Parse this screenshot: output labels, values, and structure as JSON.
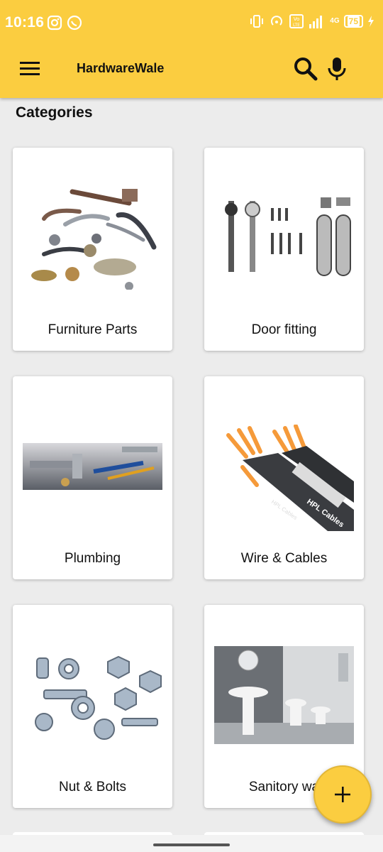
{
  "status": {
    "time": "10:16",
    "battery": "75",
    "network": "4G"
  },
  "appbar": {
    "title": "HardwareWale",
    "menu_icon": "hamburger-menu-icon",
    "search_icon": "search-icon",
    "mic_icon": "microphone-icon"
  },
  "section": {
    "title": "Categories"
  },
  "categories": [
    {
      "label": "Furniture Parts",
      "image": "furniture-handles-knobs"
    },
    {
      "label": "Door fitting",
      "image": "door-fittings-hardware"
    },
    {
      "label": "Plumbing",
      "image": "plumbing-tools"
    },
    {
      "label": "Wire & Cables",
      "image": "hpl-cables"
    },
    {
      "label": "Nut & Bolts",
      "image": "nuts-and-bolts"
    },
    {
      "label": "Sanitory wa",
      "image": "bathroom-sanitary-ware"
    }
  ],
  "fab": {
    "icon": "plus-icon"
  },
  "colors": {
    "accent": "#fbcd40",
    "background": "#ececec",
    "card": "#ffffff",
    "text": "#111111"
  }
}
